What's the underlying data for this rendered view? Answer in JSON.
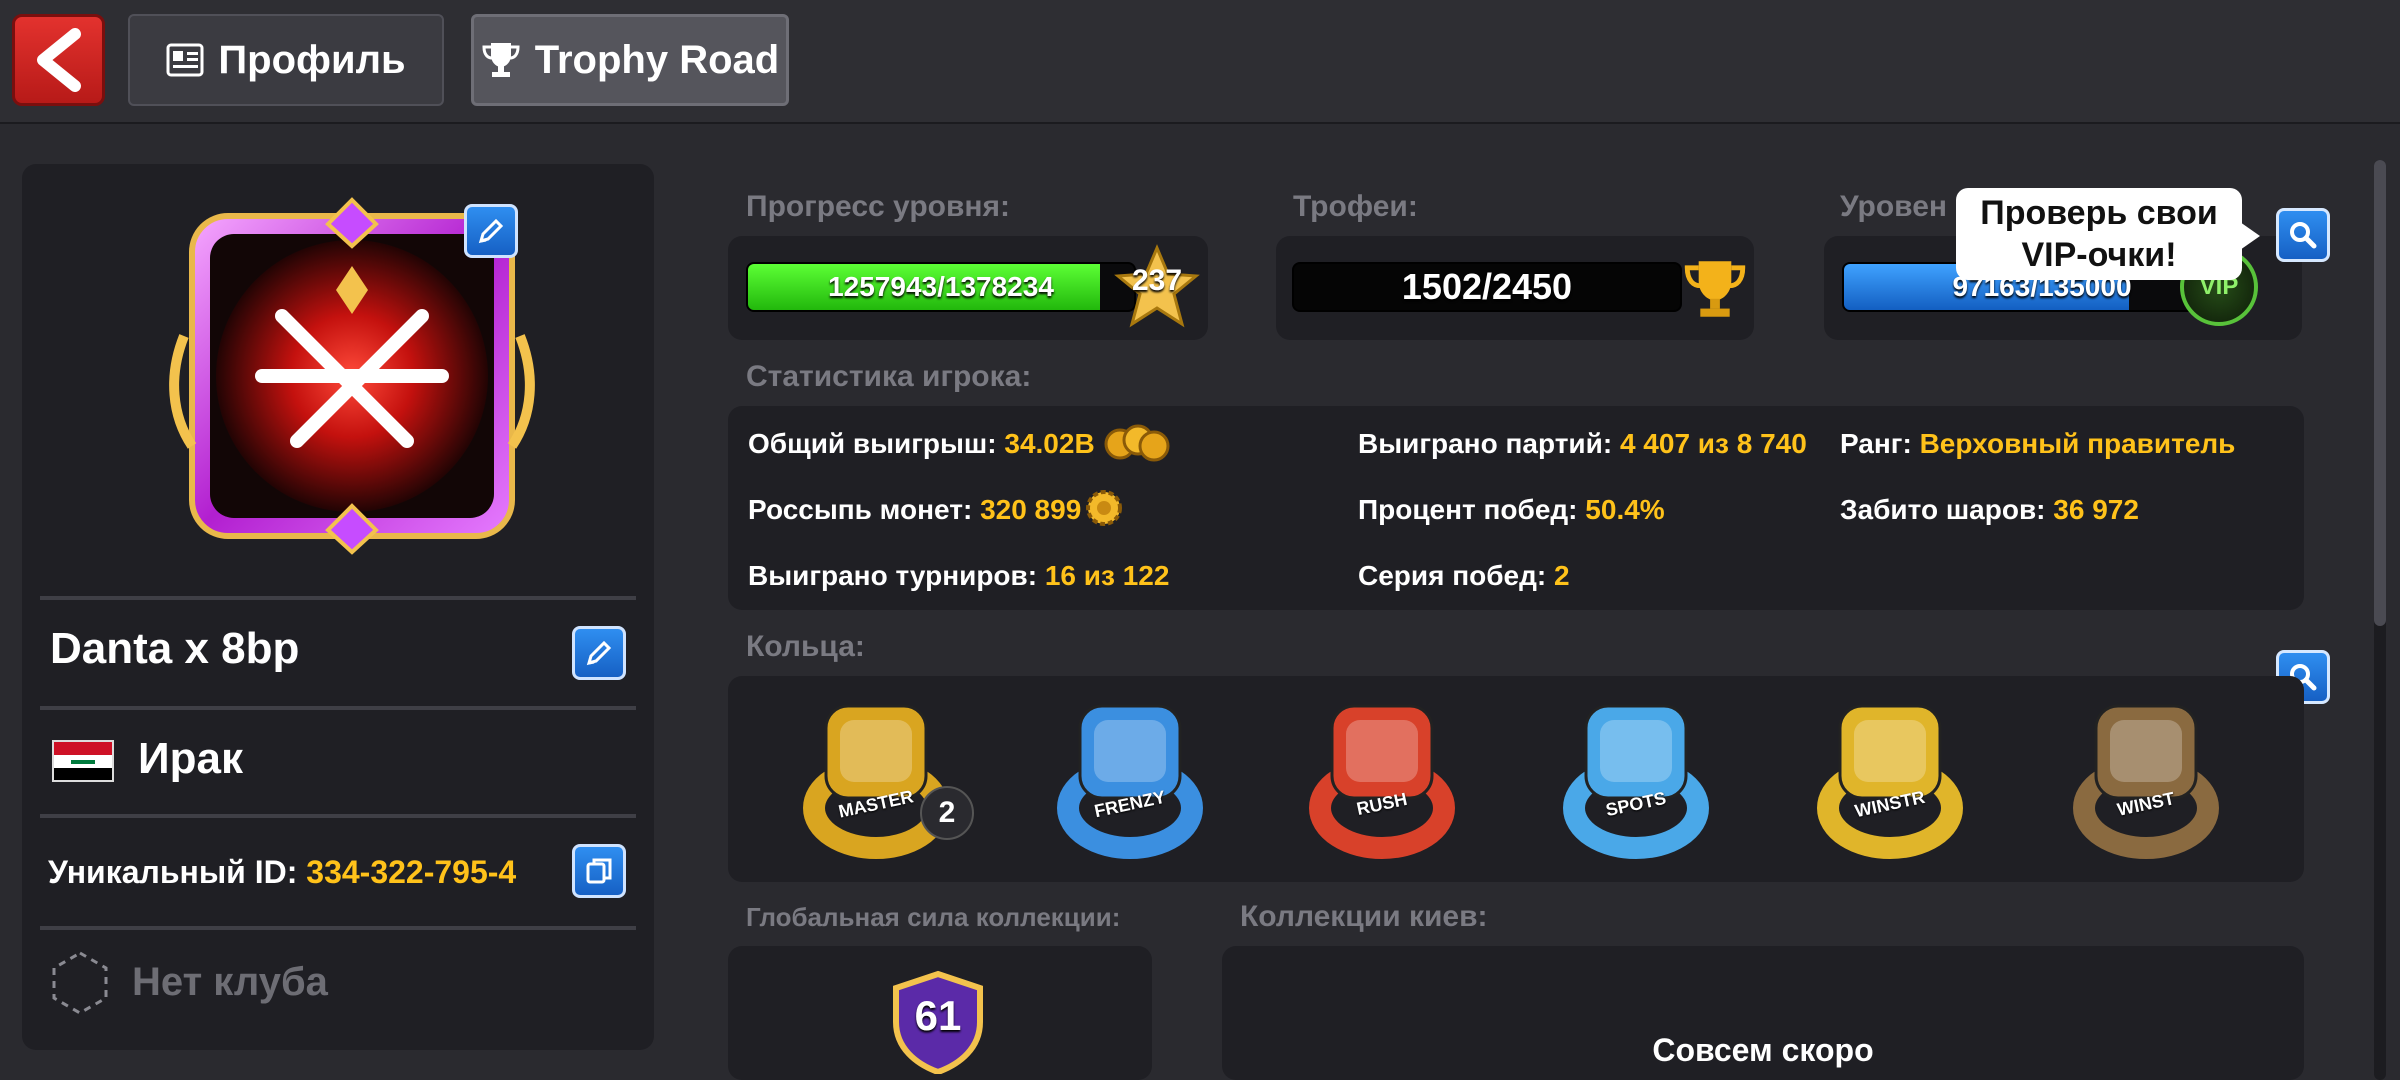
{
  "header": {
    "tabs": [
      {
        "label": "Профиль",
        "icon": "profile-card-icon",
        "active": false
      },
      {
        "label": "Trophy Road",
        "icon": "trophy-icon",
        "active": true
      }
    ]
  },
  "profile": {
    "name": "Danta x 8bp",
    "country": "Ирак",
    "unique_id_label": "Уникальный ID:",
    "unique_id": "334-322-795-4",
    "club": "Нет клуба"
  },
  "level": {
    "title": "Прогресс уровня:",
    "value": "1257943/1378234",
    "level_number": "237",
    "progress": 0.913
  },
  "trophies": {
    "title": "Трофеи:",
    "value": "1502/2450"
  },
  "vip": {
    "title": "Уровен",
    "value": "97163/135000",
    "progress": 0.72,
    "badge_text": "VIP",
    "tooltip": "Проверь свои VIP-очки!"
  },
  "stats": {
    "title": "Статистика игрока:",
    "total_win_label": "Общий выигрыш:",
    "total_win": "34.02B",
    "coin_scatter_label": "Россыпь монет:",
    "coin_scatter": "320 899",
    "tournaments_label": "Выиграно турниров:",
    "tournaments": "16 из 122",
    "games_won_label": "Выиграно партий:",
    "games_won": "4 407 из 8 740",
    "win_pct_label": "Процент побед:",
    "win_pct": "50.4%",
    "streak_label": "Серия побед:",
    "streak": "2",
    "rank_label": "Ранг:",
    "rank": "Верховный правитель",
    "balls_label": "Забито шаров:",
    "balls": "36 972"
  },
  "rings": {
    "title": "Кольца:",
    "items": [
      {
        "name": "ring-gold-master",
        "color": "#d9a520",
        "count": "2",
        "text": "MASTER"
      },
      {
        "name": "ring-blue-frenzy",
        "color": "#3b8fe0",
        "text": "FRENZY"
      },
      {
        "name": "ring-red-rush",
        "color": "#d8412a",
        "text": "RUSH"
      },
      {
        "name": "ring-blue-spots",
        "color": "#4aa8e8",
        "text": "SPOTS"
      },
      {
        "name": "ring-gold-boss",
        "color": "#e0b52a",
        "text": "WINSTR"
      },
      {
        "name": "ring-bronze-dragon",
        "color": "#8a6a40",
        "text": "WINST"
      }
    ]
  },
  "collection": {
    "power_title": "Глобальная сила коллекции:",
    "power_value": "61",
    "cues_title": "Коллекции киев:",
    "cues_status": "Совсем скоро"
  },
  "colors": {
    "accent_yellow": "#ffc21a",
    "level_bar": "#35d11b",
    "vip_bar": "#1e7be0",
    "back_red": "#d8292a"
  }
}
